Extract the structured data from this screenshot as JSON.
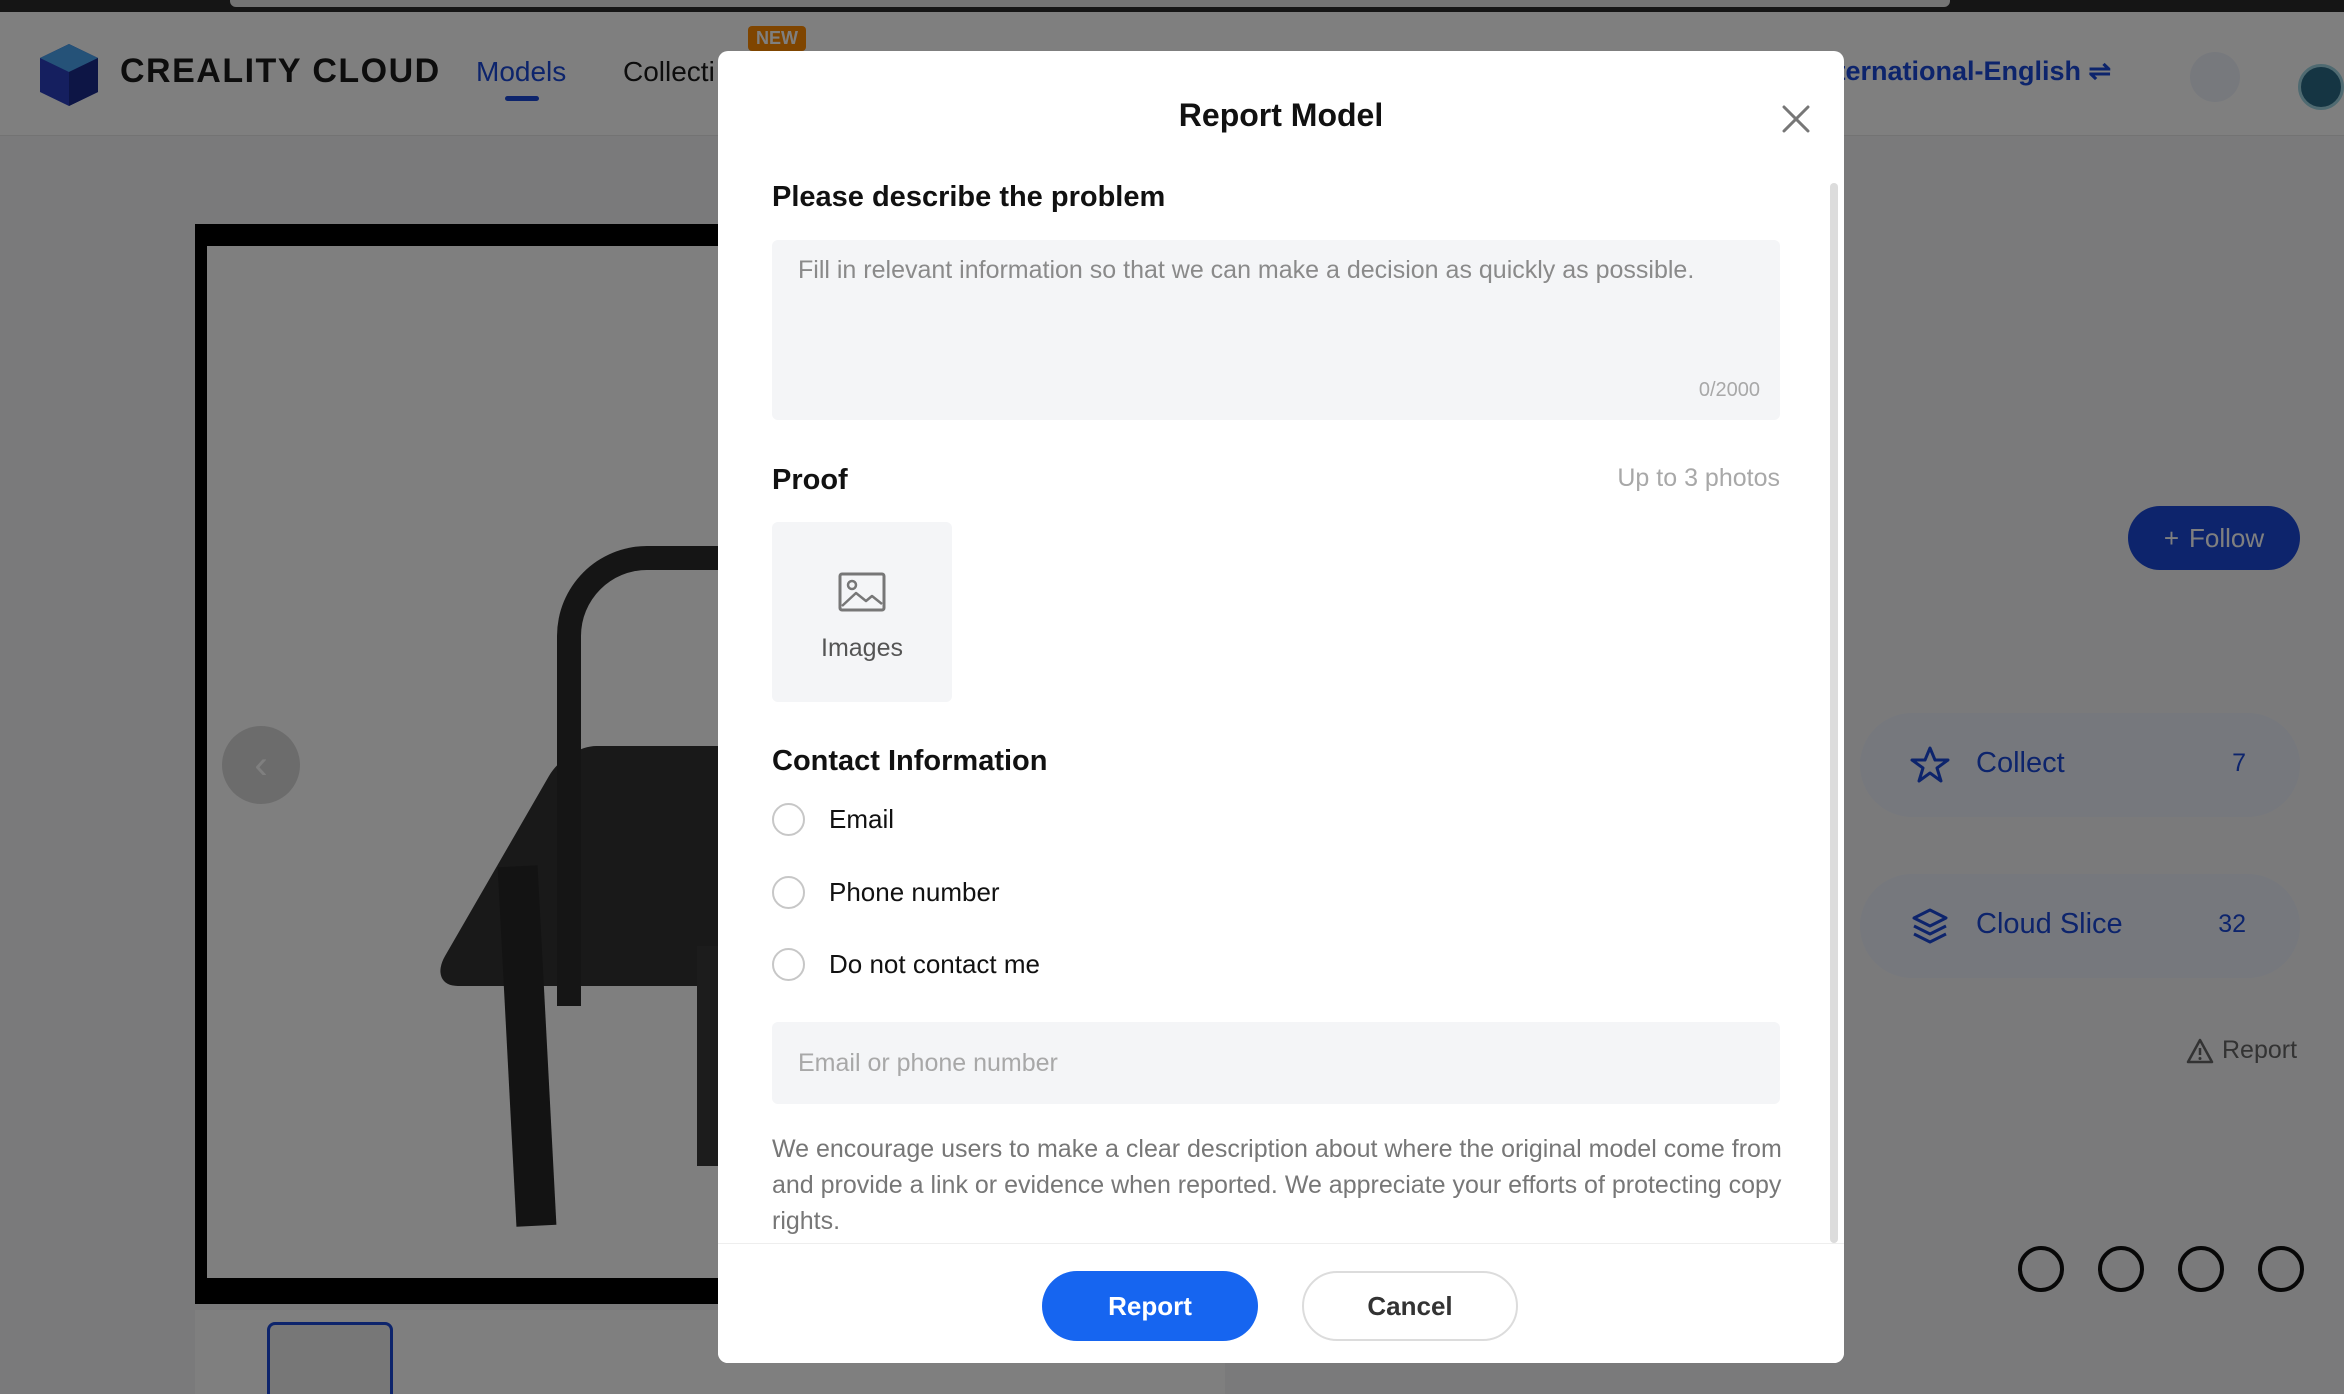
{
  "background": {
    "logo_text": "CREALITY CLOUD",
    "nav": {
      "models": "Models",
      "collections": "Collecti",
      "new_badge": "NEW"
    },
    "language": "nternational-English ⇌",
    "follow_label": "Follow",
    "actions": [
      {
        "label": "Collect",
        "count": "7",
        "icon": "star-icon"
      },
      {
        "label": "Cloud Slice",
        "count": "32",
        "icon": "layers-icon"
      }
    ],
    "report_link": "Report",
    "license_icons": [
      "cc-icon",
      "attribution-icon",
      "non-commercial-icon",
      "share-alike-icon"
    ],
    "colors": {
      "brand_blue": "#1a49d9",
      "button_blue": "#1665f0"
    }
  },
  "modal": {
    "title": "Report Model",
    "describe": {
      "label": "Please describe the problem",
      "placeholder": "Fill in relevant information so that we can make a decision as quickly as possible.",
      "value": "",
      "counter": "0/2000"
    },
    "proof": {
      "label": "Proof",
      "hint": "Up to 3 photos",
      "upload_label": "Images"
    },
    "contact": {
      "label": "Contact Information",
      "options": [
        "Email",
        "Phone number",
        "Do not contact me"
      ],
      "input_placeholder": "Email or phone number",
      "input_value": ""
    },
    "notice": "We encourage users to make a clear description about where the original model come from and provide a link or evidence when reported. We appreciate your efforts of protecting copyrights.",
    "buttons": {
      "report": "Report",
      "cancel": "Cancel"
    }
  }
}
